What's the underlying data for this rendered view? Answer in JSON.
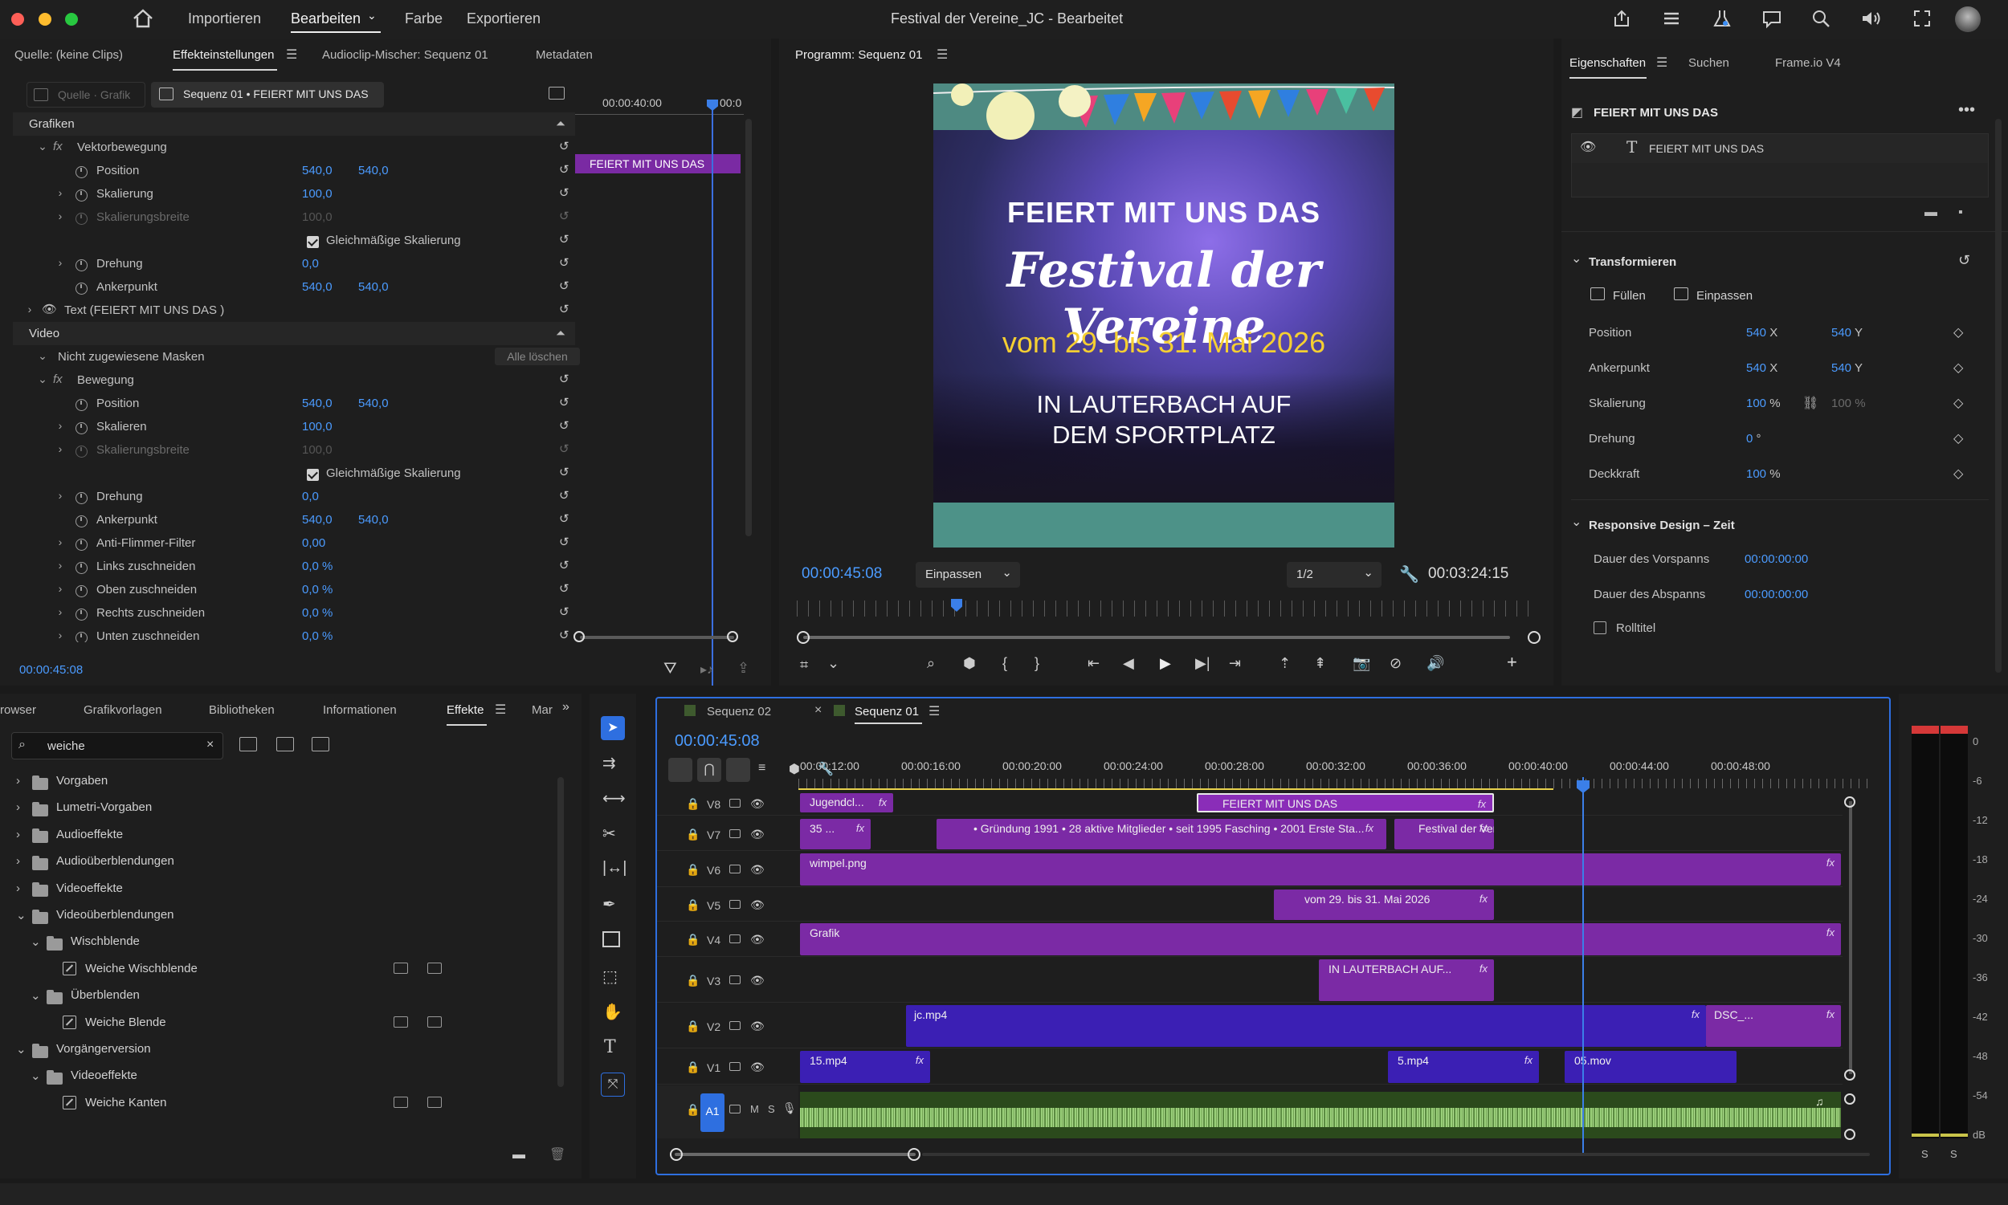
{
  "titlebar": {
    "menus": [
      "Importieren",
      "Bearbeiten",
      "Farbe",
      "Exportieren"
    ],
    "active_menu": "Bearbeiten",
    "title": "Festival der Vereine_JC - Bearbeitet"
  },
  "source_panel": {
    "tabs": [
      "Quelle: (keine Clips)",
      "Effekteinstellungen",
      "Audioclip-Mischer: Sequenz 01",
      "Metadaten"
    ],
    "active_tab": "Effekteinstellungen",
    "subtabs": [
      "Quelle · Grafik",
      "Sequenz 01 • FEIERT MIT UNS DAS"
    ],
    "mini_timecode": "00:00:40:00",
    "mini_timecode2": "00:0",
    "mini_clip": "FEIERT MIT UNS DAS",
    "timecode": "00:00:45:08",
    "section_graphics": "Grafiken",
    "section_video": "Video",
    "vector_motion": "Vektorbewegung",
    "text_layer": "Text (FEIERT MIT UNS DAS )",
    "masks": "Nicht zugewiesene Masken",
    "clear_all": "Alle löschen",
    "motion": "Bewegung",
    "rows": {
      "position": "Position",
      "scale": "Skalierung",
      "scale2": "Skalieren",
      "scale_width": "Skalierungsbreite",
      "uniform": "Gleichmäßige Skalierung",
      "rotation": "Drehung",
      "anchor": "Ankerpunkt",
      "flicker": "Anti-Flimmer-Filter",
      "crop_left": "Links zuschneiden",
      "crop_top": "Oben zuschneiden",
      "crop_right": "Rechts zuschneiden",
      "crop_bottom": "Unten zuschneiden"
    },
    "values": {
      "pos_x": "540,0",
      "pos_y": "540,0",
      "scale": "100,0",
      "scale_dim": "100,0",
      "rot": "0,0",
      "anchor_x": "540,0",
      "anchor_y": "540,0",
      "flicker": "0,00",
      "crop": "0,0 %"
    }
  },
  "program_panel": {
    "title": "Programm: Sequenz 01",
    "timecode": "00:00:45:08",
    "fit": "Einpassen",
    "resolution": "1/2",
    "duration": "00:03:24:15",
    "frame": {
      "line1": "FEIERT MIT UNS DAS",
      "line2": "Festival der Vereine",
      "line3": "vom 29. bis 31. Mai 2026",
      "line4a": "IN LAUTERBACH AUF",
      "line4b": "DEM SPORTPLATZ"
    }
  },
  "properties_panel": {
    "tabs": [
      "Eigenschaften",
      "Suchen",
      "Frame.io V4"
    ],
    "active_tab": "Eigenschaften",
    "title": "FEIERT MIT UNS DAS",
    "layer": "FEIERT MIT UNS DAS",
    "transform": "Transformieren",
    "fill": "Füllen",
    "fit": "Einpassen",
    "rows": [
      {
        "label": "Position",
        "x": "540",
        "xu": "X",
        "y": "540",
        "yu": "Y"
      },
      {
        "label": "Ankerpunkt",
        "x": "540",
        "xu": "X",
        "y": "540",
        "yu": "Y"
      },
      {
        "label": "Skalierung",
        "x": "100",
        "xu": "%",
        "y": "100",
        "yu": "%"
      },
      {
        "label": "Drehung",
        "x": "0",
        "xu": "°",
        "y": "",
        "yu": ""
      },
      {
        "label": "Deckkraft",
        "x": "100",
        "xu": "%",
        "y": "",
        "yu": ""
      }
    ],
    "responsive": "Responsive Design – Zeit",
    "intro": "Dauer des Vorspanns",
    "intro_val": "00:00:00:00",
    "outro": "Dauer des Abspanns",
    "outro_val": "00:00:00:00",
    "roll": "Rolltitel"
  },
  "effects_panel": {
    "tabs": [
      "rowser",
      "Grafikvorlagen",
      "Bibliotheken",
      "Informationen",
      "Effekte",
      "Mar"
    ],
    "active_tab": "Effekte",
    "search": "weiche",
    "tree": [
      {
        "label": "Vorgaben",
        "level": 0,
        "open": false,
        "kind": "folder"
      },
      {
        "label": "Lumetri-Vorgaben",
        "level": 0,
        "open": false,
        "kind": "folder"
      },
      {
        "label": "Audioeffekte",
        "level": 0,
        "open": false,
        "kind": "folder"
      },
      {
        "label": "Audioüberblendungen",
        "level": 0,
        "open": false,
        "kind": "folder"
      },
      {
        "label": "Videoeffekte",
        "level": 0,
        "open": false,
        "kind": "folder"
      },
      {
        "label": "Videoüberblendungen",
        "level": 0,
        "open": true,
        "kind": "folder"
      },
      {
        "label": "Wischblende",
        "level": 1,
        "open": true,
        "kind": "folder"
      },
      {
        "label": "Weiche Wischblende",
        "level": 2,
        "open": false,
        "kind": "fx"
      },
      {
        "label": "Überblenden",
        "level": 1,
        "open": true,
        "kind": "folder"
      },
      {
        "label": "Weiche Blende",
        "level": 2,
        "open": false,
        "kind": "fx"
      },
      {
        "label": "Vorgängerversion",
        "level": 0,
        "open": true,
        "kind": "folder"
      },
      {
        "label": "Videoeffekte",
        "level": 1,
        "open": true,
        "kind": "folder"
      },
      {
        "label": "Weiche Kanten",
        "level": 2,
        "open": false,
        "kind": "fx"
      }
    ]
  },
  "timeline": {
    "tabs": [
      "Sequenz 02",
      "Sequenz 01"
    ],
    "active_tab": "Sequenz 01",
    "timecode": "00:00:45:08",
    "ruler": [
      "00:00:12:00",
      "00:00:16:00",
      "00:00:20:00",
      "00:00:24:00",
      "00:00:28:00",
      "00:00:32:00",
      "00:00:36:00",
      "00:00:40:00",
      "00:00:44:00",
      "00:00:48:00"
    ],
    "tracks": [
      "V8",
      "V7",
      "V6",
      "V5",
      "V4",
      "V3",
      "V2",
      "V1"
    ],
    "audio_track": "A1",
    "audio_m": "M",
    "audio_s": "S",
    "clips": {
      "v8a": "Jugendcl...",
      "v8b": "FEIERT MIT UNS DAS",
      "v7a": "35 ...",
      "v7b": "• Gründung 1991 • 28 aktive Mitglieder • seit 1995 Fasching • 2001 Erste Sta...",
      "v7c": "Festival der Vereine",
      "v6": "wimpel.png",
      "v5": "vom 29. bis 31. Mai 2026",
      "v4": "Grafik",
      "v3": "IN LAUTERBACH AUF...",
      "v2a": "jc.mp4",
      "v2b": "DSC_...",
      "v1a": "15.mp4",
      "v1b": "5.mp4",
      "v1c": "05.mov",
      "fx": "fx"
    }
  },
  "meter": {
    "labels": [
      "0",
      "-6",
      "-12",
      "-18",
      "-24",
      "-30",
      "-36",
      "-42",
      "-48",
      "-54",
      "dB"
    ],
    "ss": [
      "S",
      "S"
    ]
  }
}
